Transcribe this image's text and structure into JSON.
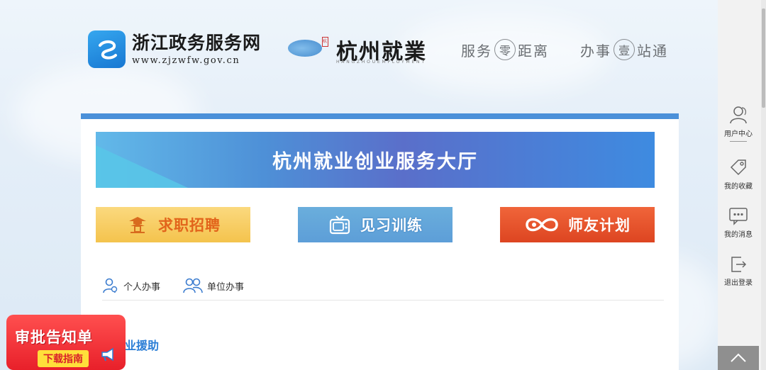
{
  "header": {
    "portal_title": "浙江政务服务网",
    "portal_url": "www.zjzwfw.gov.cn",
    "brand_title": "杭州就業",
    "brand_sub": "HANGZHOUEMPLOYMENT",
    "brand_tag": "杭",
    "slogan1": {
      "before": "服务",
      "circle": "零",
      "after": "距离"
    },
    "slogan2": {
      "before": "办事",
      "circle": "壹",
      "after": "站通"
    }
  },
  "banner": {
    "title": "杭州就业创业服务大厅"
  },
  "tiles": [
    {
      "label": "求职招聘",
      "icon": "pagoda-icon"
    },
    {
      "label": "见习训练",
      "icon": "tv-icon"
    },
    {
      "label": "师友计划",
      "icon": "infinity-icon"
    }
  ],
  "tabs": [
    {
      "label": "个人办事",
      "icon": "person-icon"
    },
    {
      "label": "单位办事",
      "icon": "group-icon"
    }
  ],
  "section": {
    "title": "业援助"
  },
  "promo": {
    "title": "审批告知单",
    "subtitle": "下载指南"
  },
  "sidebar": {
    "items": [
      {
        "label": "用户中心",
        "icon": "user-icon"
      },
      {
        "label": "我的收藏",
        "icon": "tag-icon"
      },
      {
        "label": "我的消息",
        "icon": "message-icon"
      },
      {
        "label": "退出登录",
        "icon": "logout-icon"
      }
    ]
  },
  "colors": {
    "accent": "#4a90d9",
    "promo": "#e8202a",
    "tile_orange": "#f4c34d",
    "tile_red": "#dd4521"
  }
}
